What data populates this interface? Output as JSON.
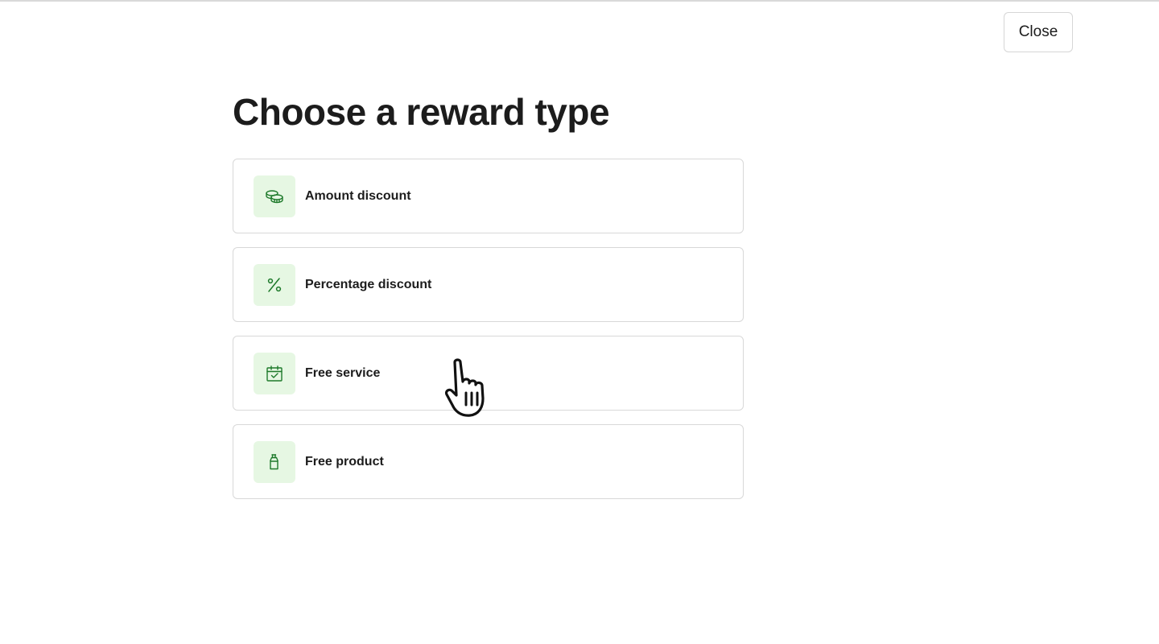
{
  "header": {
    "close_label": "Close"
  },
  "main": {
    "title": "Choose a reward type",
    "options": [
      {
        "label": "Amount discount",
        "icon": "coins-icon"
      },
      {
        "label": "Percentage discount",
        "icon": "percent-icon"
      },
      {
        "label": "Free service",
        "icon": "calendar-check-icon"
      },
      {
        "label": "Free product",
        "icon": "bottle-icon"
      }
    ]
  },
  "colors": {
    "icon_bg": "#e6f7e3",
    "icon_stroke": "#1e7a2b",
    "text": "#1c1c1c",
    "border": "#d8d8d8"
  }
}
